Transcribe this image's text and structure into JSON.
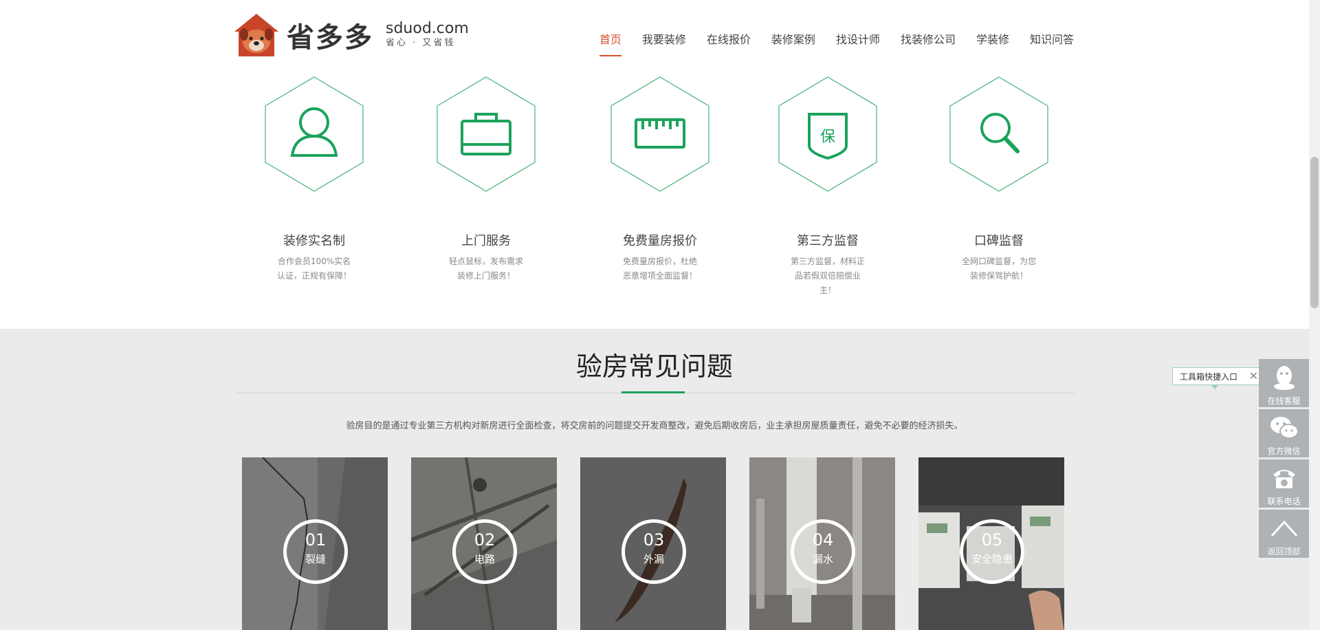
{
  "brand": {
    "cn": "省多多",
    "domain": "sduod.com",
    "slogan": "省心 · 又省钱"
  },
  "nav": [
    "首页",
    "我要装修",
    "在线报价",
    "装修案例",
    "找设计师",
    "找装修公司",
    "学装修",
    "知识问答"
  ],
  "features": [
    {
      "icon": "user-icon",
      "title": "装修实名制",
      "desc": "合作会员100%实名认证，正规有保障！"
    },
    {
      "icon": "briefcase-icon",
      "title": "上门服务",
      "desc": "轻点鼠标，发布需求装修上门服务！"
    },
    {
      "icon": "ruler-icon",
      "title": "免费量房报价",
      "desc": "免费量房报价，杜绝恶意增项全面监督！"
    },
    {
      "icon": "shield-icon",
      "shield_char": "保",
      "title": "第三方监督",
      "desc": "第三方监督，材料正品若假双倍赔偿业主！"
    },
    {
      "icon": "search-icon",
      "title": "口碑监督",
      "desc": "全网口碑监督，为您装修保驾护航！"
    }
  ],
  "faq": {
    "title": "验房常见问题",
    "intro": "验房目的是通过专业第三方机构对新房进行全面检查，将交房前的问题提交开发商整改，避免后期收房后，业主承担房屋质量责任，避免不必要的经济损失。",
    "cards": [
      {
        "num": "01",
        "label": "裂缝"
      },
      {
        "num": "02",
        "label": "电路"
      },
      {
        "num": "03",
        "label": "外漏"
      },
      {
        "num": "04",
        "label": "漏水"
      },
      {
        "num": "05",
        "label": "安全隐患"
      }
    ]
  },
  "toolbox": {
    "tip": "工具箱快捷入口",
    "close": "✕",
    "items": [
      {
        "icon": "qq-icon",
        "label": "在线客服"
      },
      {
        "icon": "wechat-icon",
        "label": "官方微信"
      },
      {
        "icon": "phone-icon",
        "label": "联系电话"
      },
      {
        "icon": "arrow-up-icon",
        "label": "返回顶部"
      }
    ]
  },
  "colors": {
    "accent_green": "#1aa35b",
    "nav_active": "#d4502c",
    "logo_red": "#c8452a"
  }
}
